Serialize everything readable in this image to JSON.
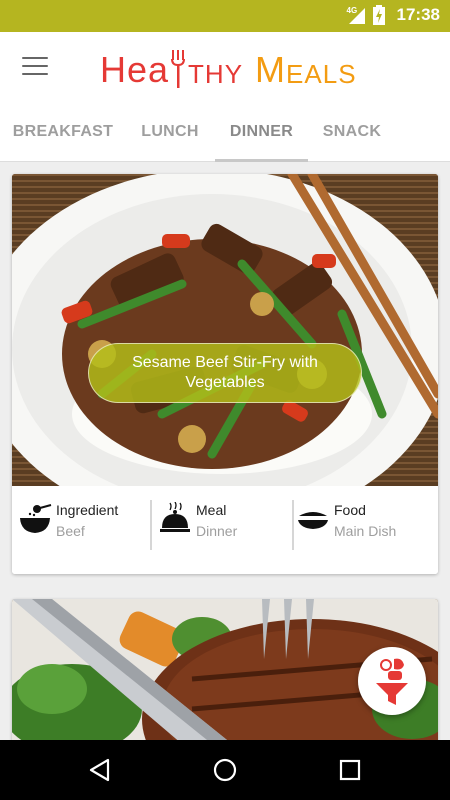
{
  "status_bar": {
    "network": "4G",
    "time": "17:38",
    "color": "#b5b520"
  },
  "app_bar": {
    "logo": {
      "part1": "Hea",
      "part2": "thy",
      "part3": "M",
      "part4": "eals"
    },
    "menu_icon": "hamburger-icon"
  },
  "tabs": [
    {
      "label": "BREAKFAST",
      "active": false
    },
    {
      "label": "LUNCH",
      "active": false
    },
    {
      "label": "DINNER",
      "active": true
    },
    {
      "label": "SNACK",
      "active": false
    }
  ],
  "cards": [
    {
      "title": "Sesame Beef Stir-Fry with Vegetables",
      "info": [
        {
          "icon": "ingredient-bowl-icon",
          "label": "Ingredient",
          "value": "Beef"
        },
        {
          "icon": "meal-cloche-icon",
          "label": "Meal",
          "value": "Dinner"
        },
        {
          "icon": "food-dish-icon",
          "label": "Food",
          "value": "Main Dish"
        }
      ]
    },
    {
      "title": "",
      "image": "grilled-steak-photo"
    }
  ],
  "fab": {
    "icon": "meat-funnel-filter-icon"
  },
  "nav_bar": {
    "buttons": [
      "back-icon",
      "home-icon",
      "recents-icon"
    ]
  },
  "colors": {
    "accent_red": "#e53935",
    "accent_orange": "#f39c12",
    "pill_green": "#b3be19"
  }
}
